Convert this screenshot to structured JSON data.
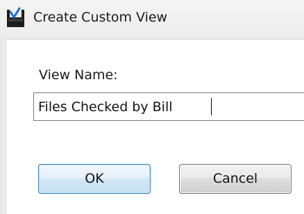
{
  "window": {
    "title": "Create Custom View",
    "icon": "custom-view-icon"
  },
  "form": {
    "view_name_label": "View Name:",
    "view_name_value": "Files Checked by Bill"
  },
  "buttons": {
    "ok_label": "OK",
    "cancel_label": "Cancel"
  },
  "colors": {
    "ok_border": "#3c7fb1",
    "cancel_border": "#707070"
  }
}
